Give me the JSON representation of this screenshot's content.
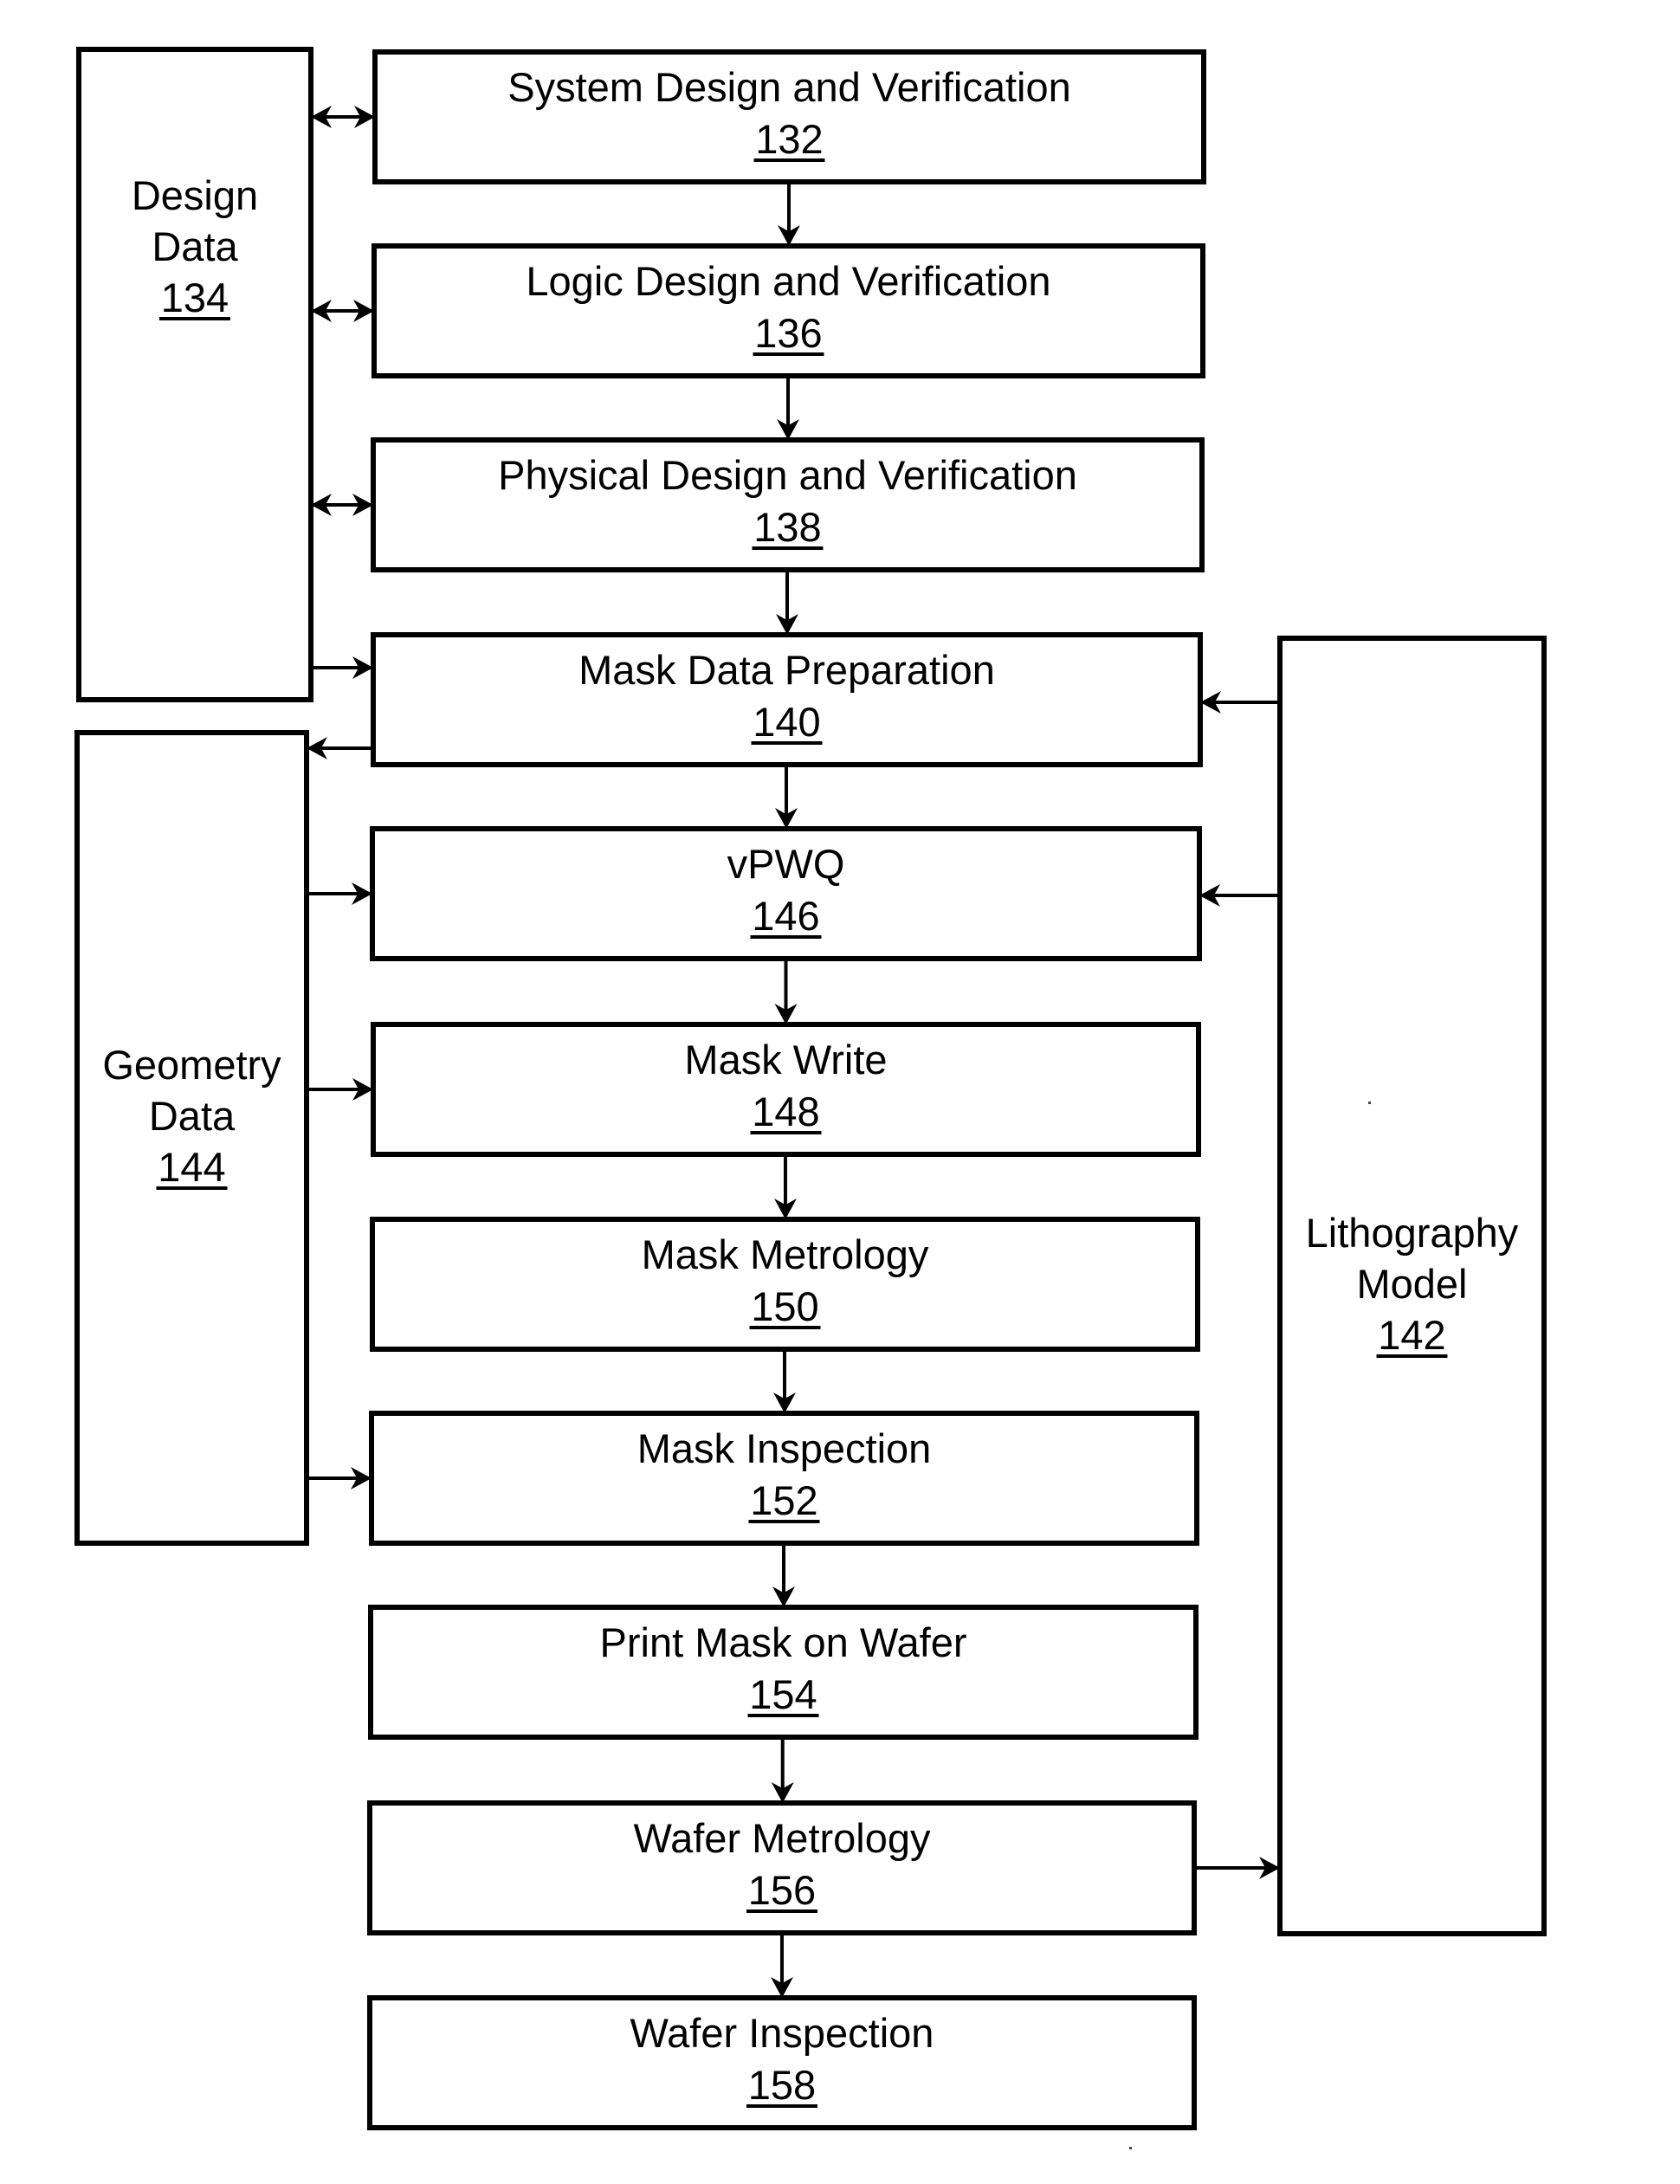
{
  "figure": {
    "type": "flowchart",
    "nodes": [
      {
        "id": "132",
        "label": "System Design and Verification",
        "ref": "132"
      },
      {
        "id": "136",
        "label": "Logic Design and Verification",
        "ref": "136"
      },
      {
        "id": "138",
        "label": "Physical Design and Verification",
        "ref": "138"
      },
      {
        "id": "140",
        "label": "Mask Data Preparation",
        "ref": "140"
      },
      {
        "id": "146",
        "label": "vPWQ",
        "ref": "146"
      },
      {
        "id": "148",
        "label": "Mask Write",
        "ref": "148"
      },
      {
        "id": "150",
        "label": "Mask Metrology",
        "ref": "150"
      },
      {
        "id": "152",
        "label": "Mask Inspection",
        "ref": "152"
      },
      {
        "id": "154",
        "label": "Print Mask on Wafer",
        "ref": "154"
      },
      {
        "id": "156",
        "label": "Wafer Metrology",
        "ref": "156"
      },
      {
        "id": "158",
        "label": "Wafer Inspection",
        "ref": "158"
      }
    ],
    "side_nodes": [
      {
        "id": "134",
        "lines": [
          "Design",
          "Data"
        ],
        "ref": "134"
      },
      {
        "id": "144",
        "lines": [
          "Geometry",
          "Data"
        ],
        "ref": "144"
      },
      {
        "id": "142",
        "lines": [
          "Lithography",
          "Model"
        ],
        "ref": "142"
      }
    ],
    "edges": [
      {
        "from": "132",
        "to": "136",
        "kind": "forward"
      },
      {
        "from": "136",
        "to": "138",
        "kind": "forward"
      },
      {
        "from": "138",
        "to": "140",
        "kind": "forward"
      },
      {
        "from": "140",
        "to": "146",
        "kind": "forward"
      },
      {
        "from": "146",
        "to": "148",
        "kind": "forward"
      },
      {
        "from": "148",
        "to": "150",
        "kind": "forward"
      },
      {
        "from": "150",
        "to": "152",
        "kind": "forward"
      },
      {
        "from": "152",
        "to": "154",
        "kind": "forward"
      },
      {
        "from": "154",
        "to": "156",
        "kind": "forward"
      },
      {
        "from": "156",
        "to": "158",
        "kind": "forward"
      },
      {
        "from": "134",
        "to": "132",
        "kind": "bidirectional"
      },
      {
        "from": "134",
        "to": "136",
        "kind": "bidirectional"
      },
      {
        "from": "134",
        "to": "138",
        "kind": "bidirectional"
      },
      {
        "from": "134",
        "to": "140",
        "kind": "forward"
      },
      {
        "from": "140",
        "to": "144",
        "kind": "forward"
      },
      {
        "from": "144",
        "to": "146",
        "kind": "forward"
      },
      {
        "from": "144",
        "to": "148",
        "kind": "forward"
      },
      {
        "from": "144",
        "to": "152",
        "kind": "forward"
      },
      {
        "from": "142",
        "to": "140",
        "kind": "forward"
      },
      {
        "from": "142",
        "to": "146",
        "kind": "forward"
      },
      {
        "from": "156",
        "to": "142",
        "kind": "forward"
      }
    ]
  }
}
